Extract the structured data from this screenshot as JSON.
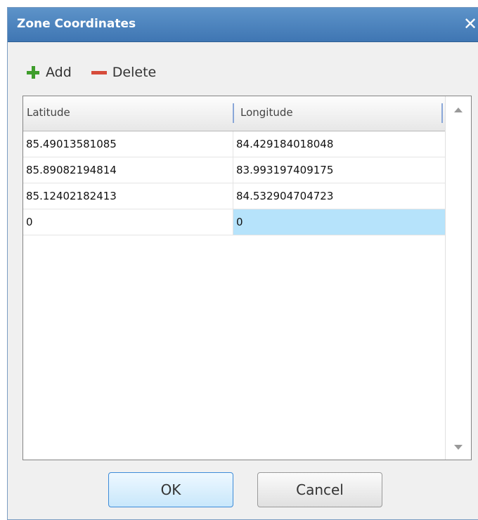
{
  "window": {
    "title": "Zone Coordinates",
    "close_icon": "close-icon"
  },
  "toolbar": {
    "add_label": "Add",
    "delete_label": "Delete",
    "add_icon": "plus-icon",
    "delete_icon": "minus-icon"
  },
  "table": {
    "columns": [
      "Latitude",
      "Longitude"
    ],
    "rows": [
      [
        "85.49013581085",
        "84.429184018048"
      ],
      [
        "85.89082194814",
        "83.993197409175"
      ],
      [
        "85.12402182413",
        "84.532904704723"
      ],
      [
        "0",
        "0"
      ]
    ],
    "selected_cell": "0"
  },
  "buttons": {
    "ok": "OK",
    "cancel": "Cancel"
  },
  "colors": {
    "accent": "#3f76b3",
    "add": "#3f9d2c",
    "delete": "#d64c3b",
    "selection": "#b6e3fb"
  }
}
